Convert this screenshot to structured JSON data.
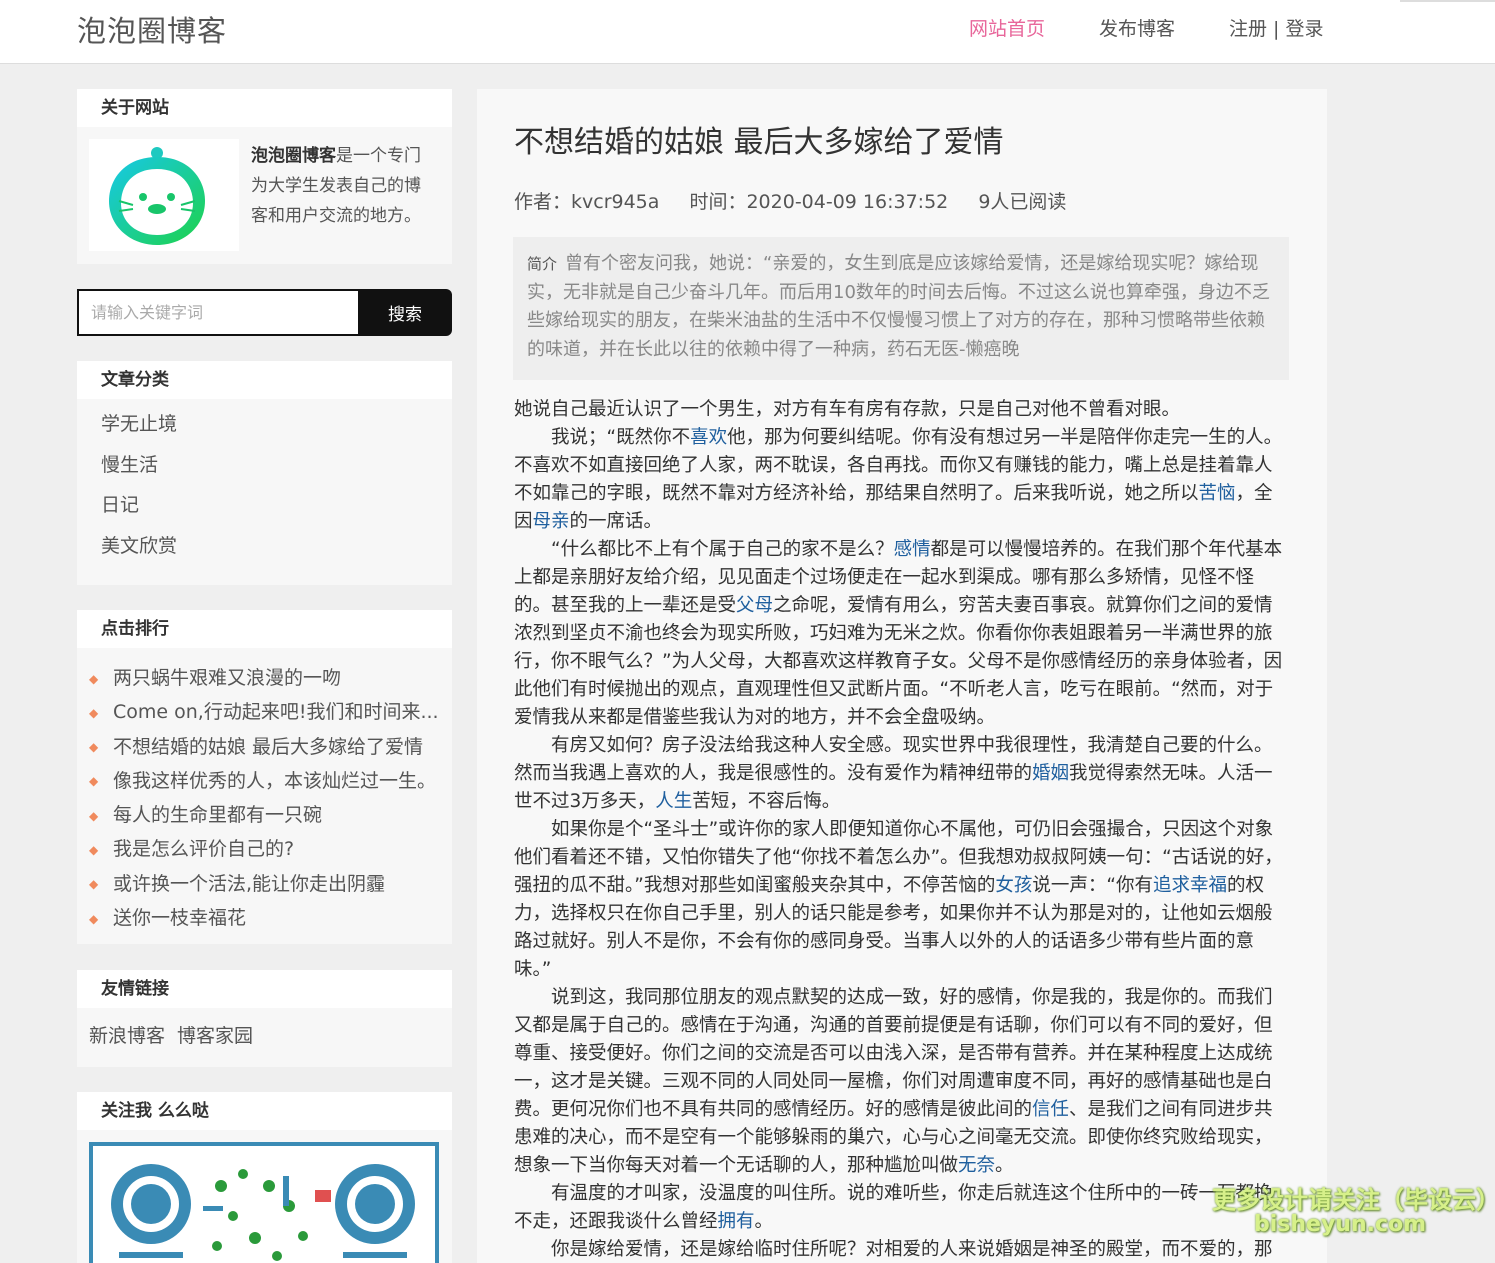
{
  "site": {
    "logo": "泡泡圈博客",
    "nav": [
      "网站首页",
      "发布博客"
    ],
    "register": "注册",
    "separator": " | ",
    "login": "登录",
    "accent": "#e8679b"
  },
  "sidebar": {
    "about": {
      "heading": "关于网站",
      "brand": "泡泡圈博客",
      "text": "是一个专门为大学生发表自己的博客和用户交流的地方。"
    },
    "search": {
      "placeholder": "请输入关键字词",
      "button": "搜索"
    },
    "categories": {
      "heading": "文章分类",
      "items": [
        "学无止境",
        "慢生活",
        "日记",
        "美文欣赏"
      ]
    },
    "ranking": {
      "heading": "点击排行",
      "items": [
        "两只蜗牛艰难又浪漫的一吻",
        "Come on,行动起来吧!我们和时间来...",
        "不想结婚的姑娘 最后大多嫁给了爱情",
        "像我这样优秀的人，本该灿烂过一生。",
        "每人的生命里都有一只碗",
        "我是怎么评价自己的?",
        "或许换一个活法,能让你走出阴霾",
        "送你一枝幸福花"
      ]
    },
    "links": {
      "heading": "友情链接",
      "items": [
        "新浪博客",
        "博客家园"
      ]
    },
    "follow": {
      "heading": "关注我 么么哒"
    }
  },
  "article": {
    "title": "不想结婚的姑娘 最后大多嫁给了爱情",
    "author": "作者：kvcr945a",
    "time": "时间：2020-04-09 16:37:52",
    "reads": "9人已阅读",
    "summary_label": "简介",
    "summary": "曾有个密友问我，她说：“亲爱的，女生到底是应该嫁给爱情，还是嫁给现实呢？嫁给现实，无非就是自己少奋斗几年。而后用10数年的时间去后悔。不过这么说也算牵强，身边不乏些嫁给现实的朋友，在柴米油盐的生活中不仅慢慢习惯上了对方的存在，那种习惯略带些依赖的味道，并在长此以往的依赖中得了一种病，药石无医-懒癌晚",
    "p1": "她说自己最近认识了一个男生，对方有车有房有存款，只是自己对他不曾看对眼。",
    "p2": [
      "我说；“既然你不",
      "喜欢",
      "他，那为何要纠结呢。你有没有想过另一半是陪伴你走完一生的人。不喜欢不如直接回绝了人家，两不耽误，各自再找。而你又有赚钱的能力，嘴上总是挂着靠人不如靠己的字眼，既然不靠对方经济补给，那结果自然明了。后来我听说，她之所以",
      "苦恼",
      "，全因",
      "母亲",
      "的一席话。"
    ],
    "p3": [
      "“什么都比不上有个属于自己的家不是么？",
      "感情",
      "都是可以慢慢培养的。在我们那个年代基本上都是亲朋好友给介绍，见见面走个过场便走在一起水到渠成。哪有那么多矫情，见怪不怪的。甚至我的上一辈还是受",
      "父母",
      "之命呢，爱情有用么，穷苦夫妻百事哀。就算你们之间的爱情浓烈到坚贞不渝也终会为现实所败，巧妇难为无米之炊。你看你你表姐跟着另一半满世界的旅行，你不眼气么？”为人父母，大都喜欢这样教育子女。父母不是你感情经历的亲身体验者，因此他们有时候抛出的观点，直观理性但又武断片面。“不听老人言，吃亏在眼前。“然而，对于爱情我从来都是借鉴些我认为对的地方，并不会全盘吸纳。"
    ],
    "p4": [
      "有房又如何？房子没法给我这种人安全感。现实世界中我很理性，我清楚自己要的什么。然而当我遇上喜欢的人，我是很感性的。没有爱作为精神纽带的",
      "婚姻",
      "我觉得索然无味。人活一世不过3万多天，",
      "人生",
      "苦短，不容后悔。"
    ],
    "p5": [
      "如果你是个“圣斗士”或许你的家人即便知道你心不属他，可仍旧会强撮合，只因这个对象他们看着还不错，又怕你错失了他“你找不着怎么办”。但我想劝叔叔阿姨一句：“古话说的好，强扭的瓜不甜。”我想对那些如闺蜜般夹杂其中，不停苦恼的",
      "女孩",
      "说一声：“你有",
      "追求幸福",
      "的权力，选择权只在你自己手里，别人的话只能是参考，如果你并不认为那是对的，让他如云烟般路过就好。别人不是你，不会有你的感同身受。当事人以外的人的话语多少带有些片面的意味。”"
    ],
    "p6": [
      "说到这，我同那位朋友的观点默契的达成一致，好的感情，你是我的，我是你的。而我们又都是属于自己的。感情在于沟通，沟通的首要前提便是有话聊，你们可以有不同的爱好，但尊重、接受便好。你们之间的交流是否可以由浅入深，是否带有营养。并在某种程度上达成统一，这才是关键。三观不同的人同处同一屋檐，你们对周遭审度不同，再好的感情基础也是白费。更何况你们也不具有共同的感情经历。好的感情是彼此间的",
      "信任",
      "、是我们之间有同进步共患难的决心，而不是空有一个能够躲雨的巢穴，心与心之间毫无交流。即使你终究败给现实，想象一下当你每天对着一个无话聊的人，那种尴尬叫做",
      "无奈",
      "。"
    ],
    "p7": [
      "有温度的才叫家，没温度的叫住所。说的难听些，你走后就连这个住所中的一砖一瓦都挽不走，还跟我谈什么曾经",
      "拥有",
      "。"
    ],
    "p8": "你是嫁给爱情，还是嫁给临时住所呢？对相爱的人来说婚姻是神圣的殿堂，而不爱的，那"
  },
  "watermark": [
    "更多设计请关注（毕设云）",
    "bisheyun.com"
  ]
}
